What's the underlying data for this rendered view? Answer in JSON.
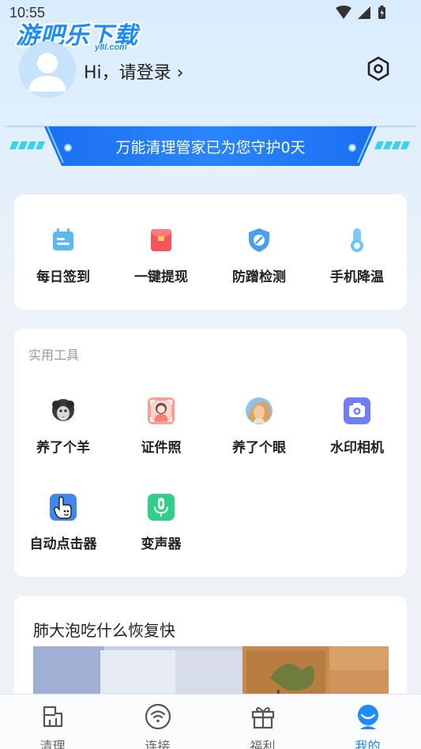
{
  "status_bar": {
    "time": "10:55"
  },
  "watermark": {
    "main": "游吧乐下载",
    "sub": "y8l.com"
  },
  "profile": {
    "login_text": "Hi，请登录 ›"
  },
  "banner": {
    "text": "万能清理管家已为您守护0天"
  },
  "quick_actions": [
    {
      "label": "每日签到",
      "icon": "calendar-icon",
      "color": "#5bb7f0"
    },
    {
      "label": "一键提现",
      "icon": "red-envelope-icon",
      "color": "#f2555a"
    },
    {
      "label": "防蹭检测",
      "icon": "shield-icon",
      "color": "#4a9ff5"
    },
    {
      "label": "手机降温",
      "icon": "thermometer-icon",
      "color": "#6cc3f5"
    }
  ],
  "tools": {
    "section_title": "实用工具",
    "items": [
      {
        "label": "养了个羊",
        "icon": "sheep-icon"
      },
      {
        "label": "证件照",
        "icon": "id-photo-icon"
      },
      {
        "label": "养了个眼",
        "icon": "eye-avatar-icon"
      },
      {
        "label": "水印相机",
        "icon": "camera-icon"
      },
      {
        "label": "自动点击器",
        "icon": "auto-clicker-icon"
      },
      {
        "label": "变声器",
        "icon": "voice-changer-icon"
      }
    ]
  },
  "article": {
    "title": "肺大泡吃什么恢复快"
  },
  "tabs": [
    {
      "label": "清理",
      "icon": "clean-icon",
      "active": false
    },
    {
      "label": "连接",
      "icon": "wifi-icon",
      "active": false
    },
    {
      "label": "福利",
      "icon": "gift-icon",
      "active": false
    },
    {
      "label": "我的",
      "icon": "profile-icon",
      "active": true
    }
  ],
  "colors": {
    "accent": "#1e8bff",
    "banner": "#1a6ff0",
    "background": "#eef2f7"
  }
}
